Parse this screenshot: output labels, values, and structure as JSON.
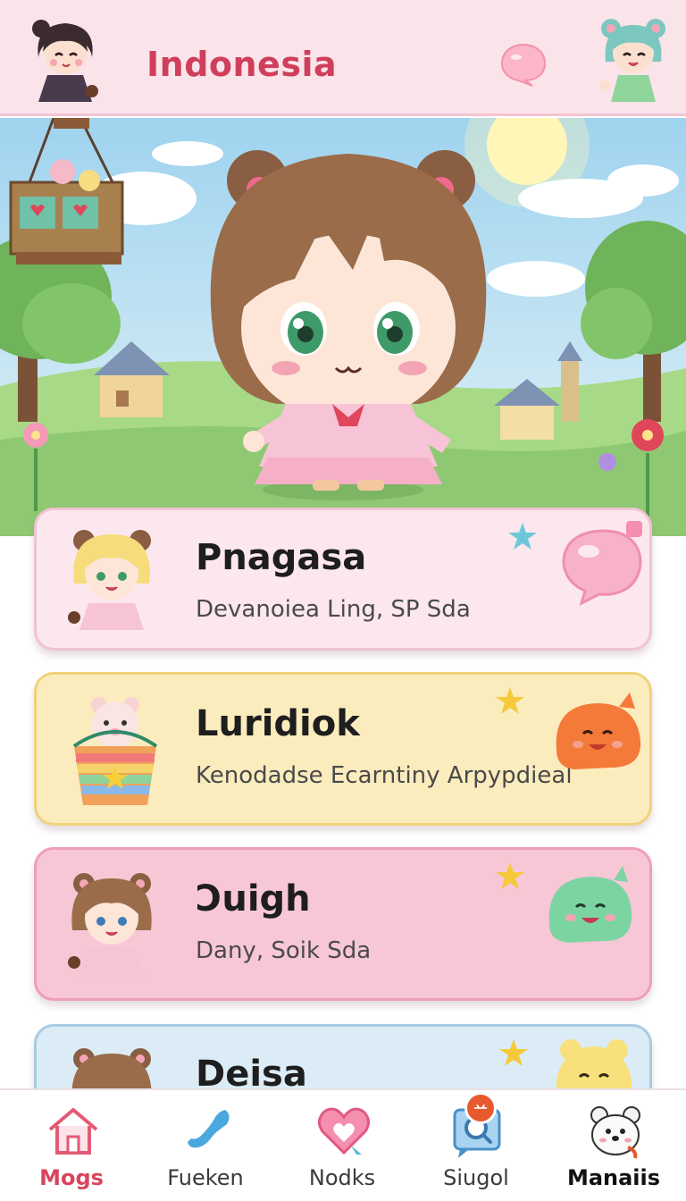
{
  "header": {
    "title": "Indonesia",
    "icons": {
      "left_avatar": "girl-avatar-icon",
      "bubble": "chat-bubble-icon",
      "right_avatar": "bear-girl-avatar-icon"
    }
  },
  "hero": {
    "illustration": "chibi-bear-girl-scene"
  },
  "cards": [
    {
      "title": "Pnagasa",
      "subtitle": "Devanoiea Ling, SP Sda",
      "color": "#fce7ee",
      "avatar": "blonde-bear-girl-icon",
      "deco": "pink-bubble-icon"
    },
    {
      "title": "Luridiok",
      "subtitle": "Kenodadse Ecarntiny Arpypdieal",
      "color": "#fbecbe",
      "avatar": "bear-in-bucket-icon",
      "deco": "orange-slime-icon"
    },
    {
      "title": "Ɔuigh",
      "subtitle": "Dany, Soik Sda",
      "color": "#f8c7d6",
      "avatar": "brown-bear-girl-icon",
      "deco": "green-slime-icon"
    },
    {
      "title": "Deisa",
      "subtitle": "",
      "color": "#dcecf7",
      "avatar": "bear-girl-icon",
      "deco": "yellow-bear-icon"
    }
  ],
  "nav": [
    {
      "label": "Mogs",
      "icon": "home-icon",
      "active": true
    },
    {
      "label": "Fueken",
      "icon": "phone-icon",
      "active": false
    },
    {
      "label": "Nodks",
      "icon": "heart-icon",
      "active": false
    },
    {
      "label": "Siugol",
      "icon": "search-icon",
      "active": false,
      "badge": "䒑"
    },
    {
      "label": "Manaiis",
      "icon": "bear-face-icon",
      "active": false
    }
  ],
  "colors": {
    "accent": "#cf3f5c",
    "header_bg": "#fbe3ea"
  }
}
